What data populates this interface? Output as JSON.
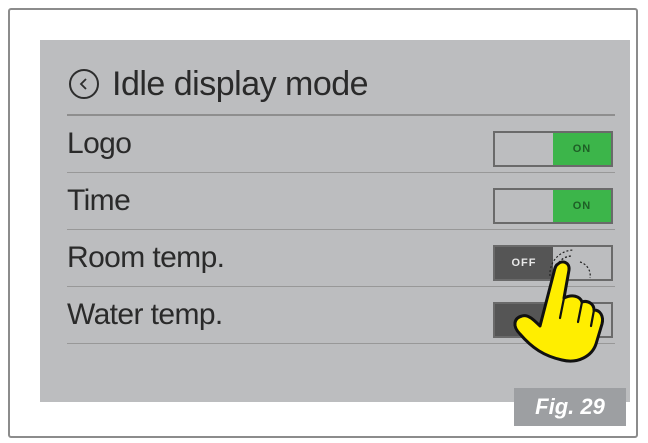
{
  "screen": {
    "title": "Idle display mode",
    "rows": [
      {
        "label": "Logo",
        "state": "ON"
      },
      {
        "label": "Time",
        "state": "ON"
      },
      {
        "label": "Room temp.",
        "state": "OFF"
      },
      {
        "label": "Water temp.",
        "state": ""
      }
    ]
  },
  "figure_label": "Fig. 29",
  "icons": {
    "back": "back-arrow-circle-icon",
    "pointer": "tapping-hand-icon"
  },
  "colors": {
    "screen_bg": "#bcbdbf",
    "on": "#3cb54a",
    "off": "#555555",
    "hand": "#ffee00"
  }
}
